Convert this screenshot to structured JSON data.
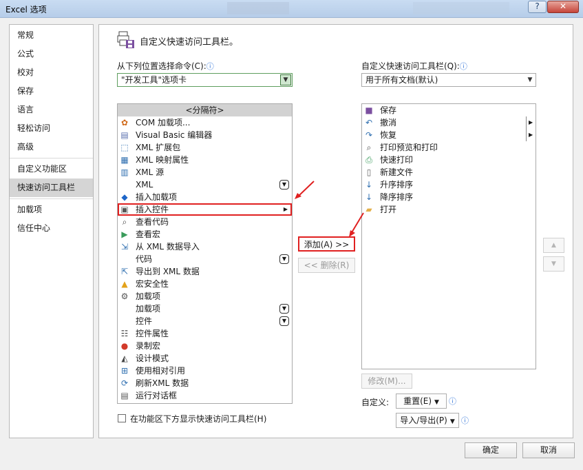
{
  "window": {
    "title": "Excel 选项",
    "help": "?",
    "close": "✕"
  },
  "sidebar": {
    "items": [
      "常规",
      "公式",
      "校对",
      "保存",
      "语言",
      "轻松访问",
      "高级",
      "自定义功能区",
      "快速访问工具栏",
      "加载项",
      "信任中心"
    ],
    "selected": "快速访问工具栏"
  },
  "panel": {
    "heading": "自定义快速访问工具栏。",
    "choose_label": "从下列位置选择命令(C):",
    "choose_value": "\"开发工具\"选项卡",
    "customize_label": "自定义快速访问工具栏(Q):",
    "customize_value": "用于所有文档(默认)",
    "left_list": [
      {
        "label": "<分隔符>",
        "icon": "separator",
        "extra": ""
      },
      {
        "label": "COM 加载项...",
        "icon": "com-addin-icon",
        "extra": ""
      },
      {
        "label": "Visual Basic 编辑器",
        "icon": "vb-editor-icon",
        "extra": ""
      },
      {
        "label": "XML 扩展包",
        "icon": "xml-expansion-icon",
        "extra": ""
      },
      {
        "label": "XML 映射属性",
        "icon": "xml-map-icon",
        "extra": ""
      },
      {
        "label": "XML 源",
        "icon": "xml-source-icon",
        "extra": ""
      },
      {
        "label": "XML",
        "icon": "",
        "extra": "expand"
      },
      {
        "label": "插入加载项",
        "icon": "insert-addin-icon",
        "extra": ""
      },
      {
        "label": "插入控件",
        "icon": "insert-control-icon",
        "extra": "submenu"
      },
      {
        "label": "查看代码",
        "icon": "view-code-icon",
        "extra": ""
      },
      {
        "label": "查看宏",
        "icon": "view-macro-icon",
        "extra": ""
      },
      {
        "label": "从 XML 数据导入",
        "icon": "xml-import-icon",
        "extra": ""
      },
      {
        "label": "代码",
        "icon": "",
        "extra": "expand"
      },
      {
        "label": "导出到 XML 数据",
        "icon": "xml-export-icon",
        "extra": ""
      },
      {
        "label": "宏安全性",
        "icon": "warning-icon",
        "extra": ""
      },
      {
        "label": "加载项",
        "icon": "addins-gear-icon",
        "extra": ""
      },
      {
        "label": "加载项",
        "icon": "",
        "extra": "expand"
      },
      {
        "label": "控件",
        "icon": "",
        "extra": "expand"
      },
      {
        "label": "控件属性",
        "icon": "control-properties-icon",
        "extra": ""
      },
      {
        "label": "录制宏",
        "icon": "record-macro-icon",
        "extra": ""
      },
      {
        "label": "设计模式",
        "icon": "design-mode-icon",
        "extra": ""
      },
      {
        "label": "使用相对引用",
        "icon": "relative-ref-icon",
        "extra": ""
      },
      {
        "label": "刷新XML 数据",
        "icon": "refresh-xml-icon",
        "extra": ""
      },
      {
        "label": "运行对话框",
        "icon": "run-dialog-icon",
        "extra": ""
      }
    ],
    "right_list": [
      {
        "label": "保存",
        "icon": "save-icon",
        "extra": ""
      },
      {
        "label": "撤消",
        "icon": "undo-icon",
        "extra": "split"
      },
      {
        "label": "恢复",
        "icon": "redo-icon",
        "extra": "split"
      },
      {
        "label": "打印预览和打印",
        "icon": "print-preview-icon",
        "extra": ""
      },
      {
        "label": "快速打印",
        "icon": "quick-print-icon",
        "extra": ""
      },
      {
        "label": "新建文件",
        "icon": "new-file-icon",
        "extra": ""
      },
      {
        "label": "升序排序",
        "icon": "sort-asc-icon",
        "extra": ""
      },
      {
        "label": "降序排序",
        "icon": "sort-desc-icon",
        "extra": ""
      },
      {
        "label": "打开",
        "icon": "open-folder-icon",
        "extra": ""
      }
    ],
    "add_button": "添加(A) >>",
    "remove_button": "<< 删除(R)",
    "modify_button": "修改(M)...",
    "customize_label2": "自定义:",
    "reset_button": "重置(E)",
    "import_export_button": "导入/导出(P)",
    "below_ribbon_checkbox": "在功能区下方显示快速访问工具栏(H)",
    "info_glyph": "ⓘ"
  },
  "footer": {
    "ok": "确定",
    "cancel": "取消"
  },
  "colors": {
    "highlight": "#e02020",
    "selected_sidebar": "#d5d5d5"
  }
}
